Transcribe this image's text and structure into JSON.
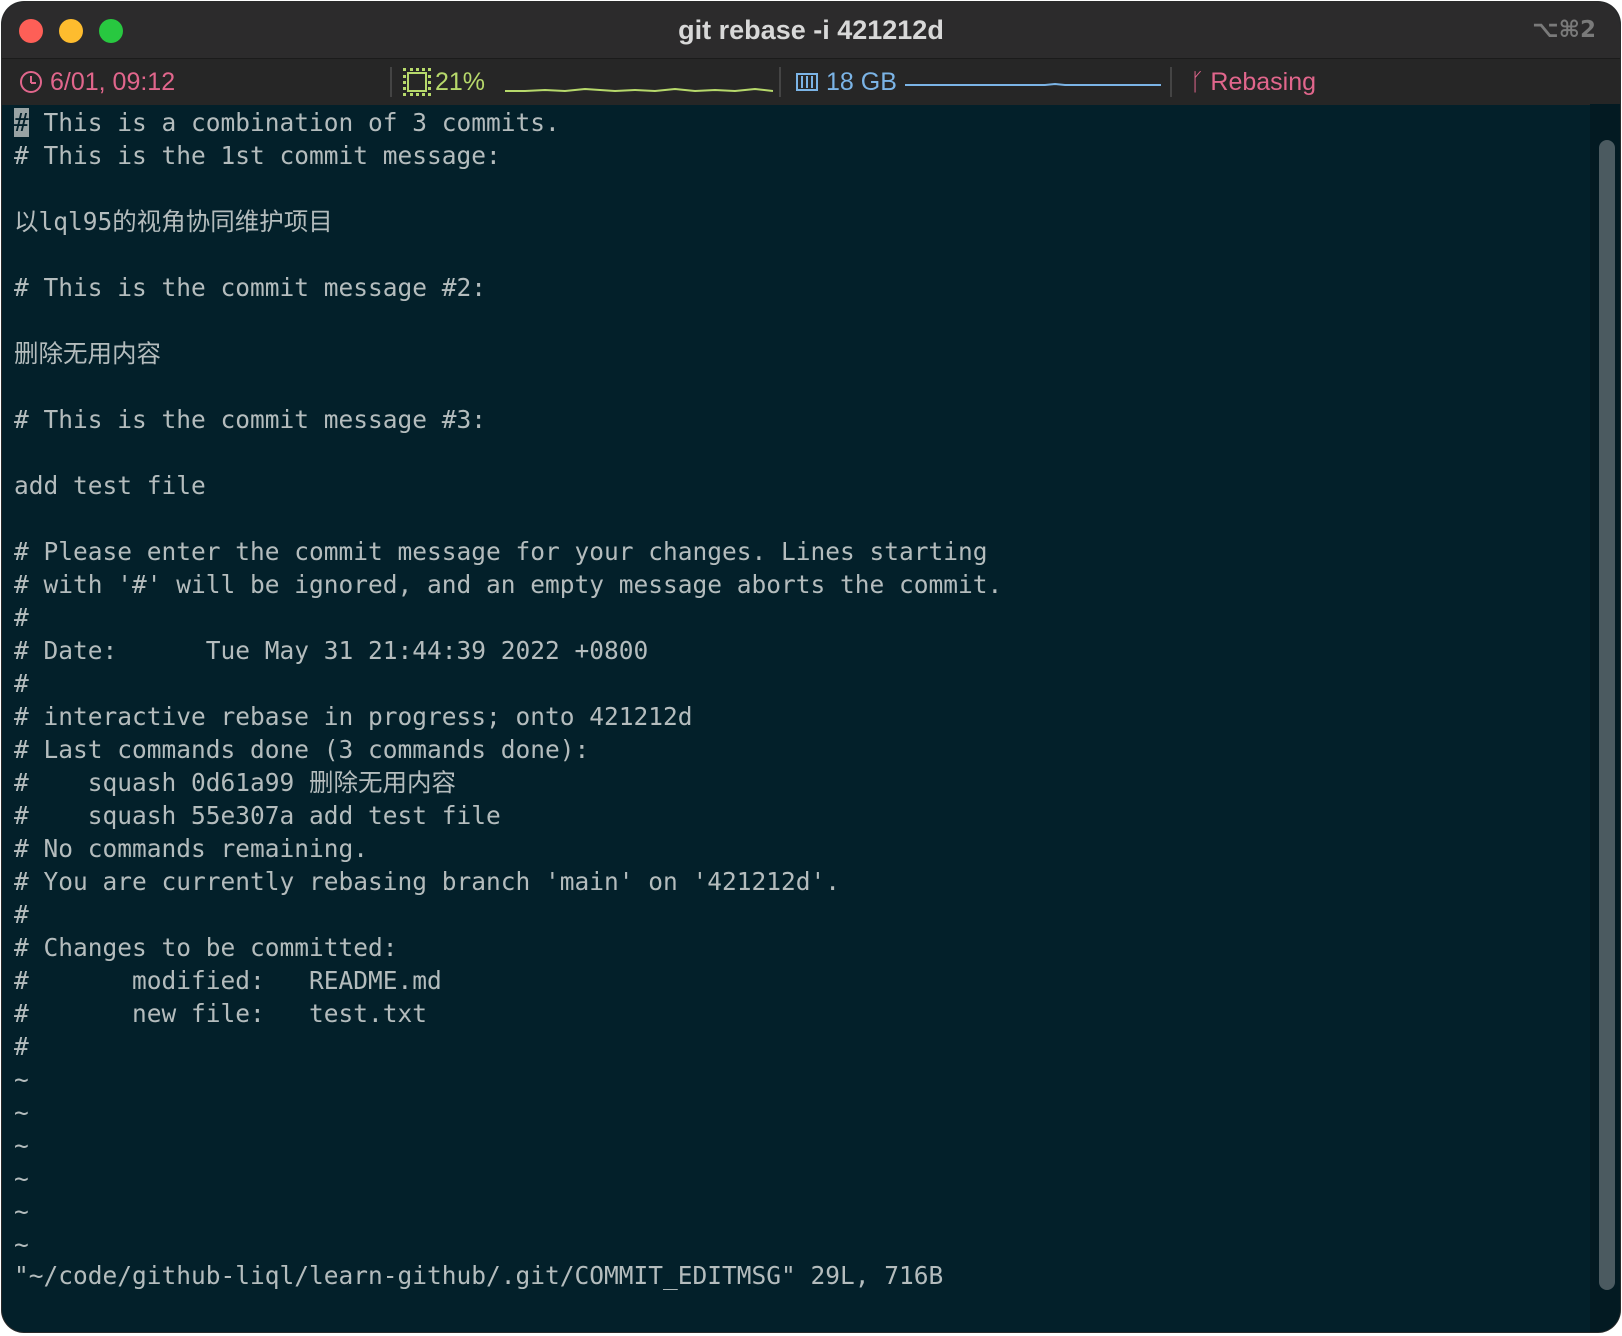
{
  "window": {
    "title": "git rebase -i 421212d",
    "shortcut": "⌥⌘2"
  },
  "statusbar": {
    "datetime": "6/01, 09:12",
    "cpu": "21%",
    "memory": "18 GB",
    "git_status": "Rebasing",
    "colors": {
      "clock": "#e1668c",
      "cpu": "#b7d96b",
      "memory": "#7bb4e6",
      "git": "#e1668c"
    }
  },
  "editor": {
    "lines": [
      " This is a combination of 3 commits.",
      "# This is the 1st commit message:",
      "",
      "以lql95的视角协同维护项目",
      "",
      "# This is the commit message #2:",
      "",
      "删除无用内容",
      "",
      "# This is the commit message #3:",
      "",
      "add test file",
      "",
      "# Please enter the commit message for your changes. Lines starting",
      "# with '#' will be ignored, and an empty message aborts the commit.",
      "#",
      "# Date:      Tue May 31 21:44:39 2022 +0800",
      "#",
      "# interactive rebase in progress; onto 421212d",
      "# Last commands done (3 commands done):",
      "#    squash 0d61a99 删除无用内容",
      "#    squash 55e307a add test file",
      "# No commands remaining.",
      "# You are currently rebasing branch 'main' on '421212d'.",
      "#",
      "# Changes to be committed:",
      "#       modified:   README.md",
      "#       new file:   test.txt",
      "#",
      "~",
      "~",
      "~",
      "~",
      "~",
      "~"
    ],
    "cursor_char": "#",
    "status_line": "\"~/code/github-liql/learn-github/.git/COMMIT_EDITMSG\" 29L, 716B"
  }
}
